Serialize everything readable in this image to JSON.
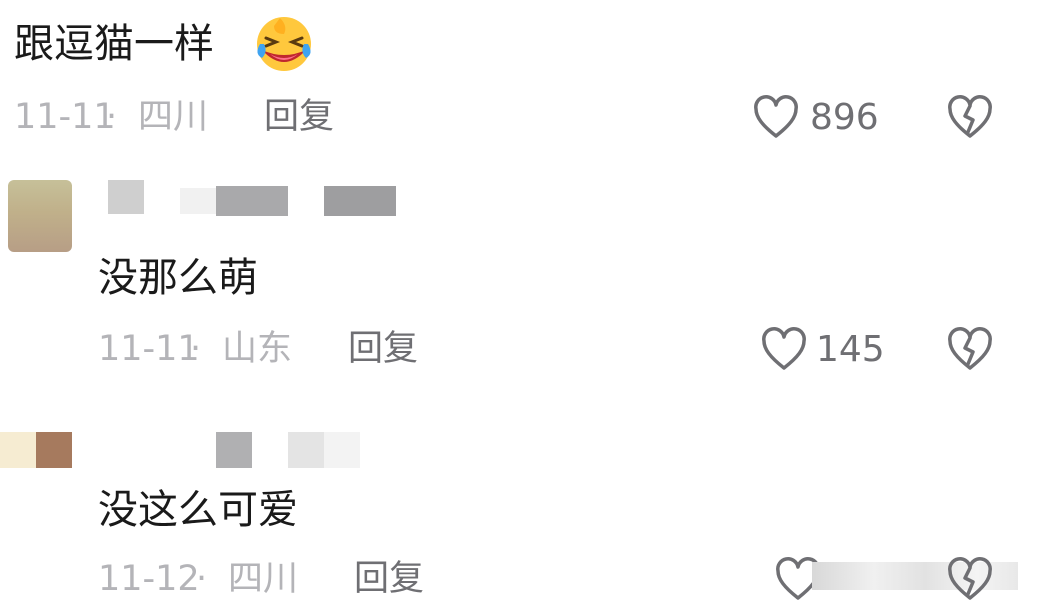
{
  "comments": [
    {
      "text": "跟逗猫一样",
      "emoji": "grinning-squint-tears-emoji",
      "date": "11-11",
      "separator": "·",
      "location": "四川",
      "reply_label": "回复",
      "likes": "896"
    },
    {
      "text": "没那么萌",
      "date": "11-11",
      "separator": "·",
      "location": "山东",
      "reply_label": "回复",
      "likes": "145"
    },
    {
      "text": "没这么可爱",
      "date": "11-12",
      "separator": "·",
      "location": "四川",
      "reply_label": "回复"
    }
  ],
  "icons": {
    "like": "heart-outline-icon",
    "dislike": "broken-heart-icon"
  },
  "colors": {
    "text": "#1a1a1a",
    "meta": "#b4b4b8",
    "reply": "#6f6f73"
  }
}
